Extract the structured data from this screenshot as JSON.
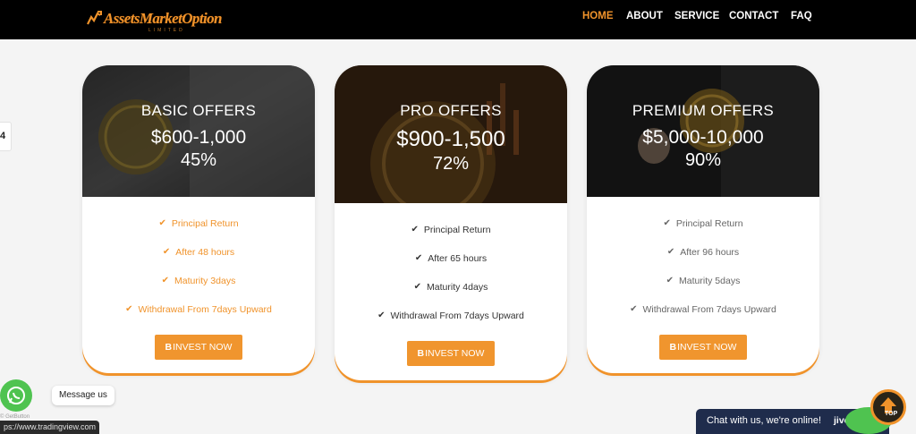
{
  "nav": {
    "logo_text": "AssetsMarketOption",
    "logo_sub": "LIMITED",
    "items": [
      {
        "label": "HOME",
        "active": true
      },
      {
        "label": "ABOUT",
        "active": false
      },
      {
        "label": "SERVICE",
        "active": false
      },
      {
        "label": "CONTACT",
        "active": false
      },
      {
        "label": "FAQ",
        "active": false
      }
    ]
  },
  "side_tab": {
    "glyph": "4"
  },
  "plans": [
    {
      "title": "BASIC OFFERS",
      "price": "$600-1,000",
      "percent": "45%",
      "features": [
        "Principal Return",
        "After 48 hours",
        "Maturity 3days",
        "Withdrawal From 7days Upward"
      ],
      "button_icon": "B",
      "button_label": "INVEST NOW",
      "feature_color": "#f0932b"
    },
    {
      "title": "PRO OFFERS",
      "price": "$900-1,500",
      "percent": "72%",
      "features": [
        "Principal Return",
        "After 65 hours",
        "Maturity 4days",
        "Withdrawal From 7days Upward"
      ],
      "button_icon": "B",
      "button_label": "INVEST NOW",
      "feature_color": "#333333"
    },
    {
      "title": "PREMIUM OFFERS",
      "price": "$5,000-10,000",
      "percent": "90%",
      "features": [
        "Principal Return",
        "After 96 hours",
        "Maturity 5days",
        "Withdrawal From 7days Upward"
      ],
      "button_icon": "B",
      "button_label": "INVEST NOW",
      "feature_color": "#666666"
    }
  ],
  "whatsapp": {
    "message": "Message us",
    "copyright": "© GetButton"
  },
  "status_url": "ps://www.tradingview.com",
  "chat": {
    "text": "Chat with us, we're online!",
    "brand": "jivochat"
  },
  "top_button": {
    "label": "TOP"
  },
  "colors": {
    "accent": "#f0932b",
    "navbar": "#000000",
    "chat": "#1f2c4c",
    "whatsapp": "#4fc350"
  }
}
